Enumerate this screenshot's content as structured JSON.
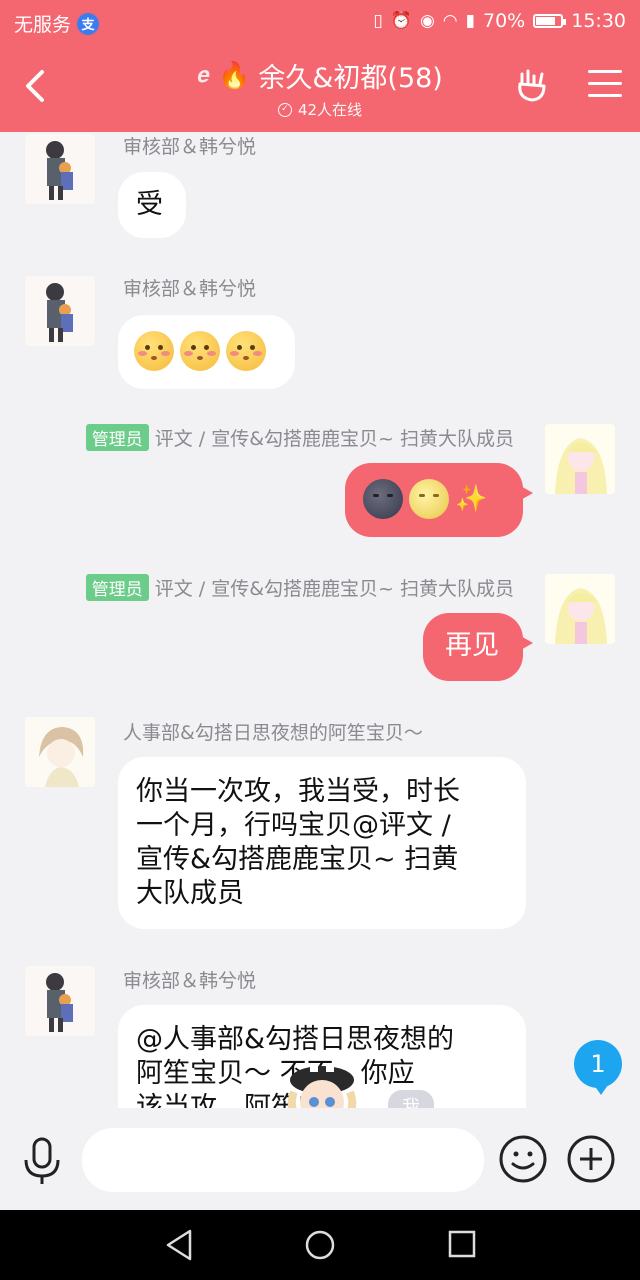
{
  "status_bar": {
    "carrier": "无服务",
    "alipay_icon": "支",
    "battery": "70%",
    "battery_level": 0.7,
    "time": "15:30"
  },
  "header": {
    "title": "余久&初都(58)",
    "online": "42人在线"
  },
  "messages": [
    {
      "sender": "审核部＆韩兮悦",
      "text": "受"
    },
    {
      "sender": "审核部＆韩兮悦",
      "emoji": [
        "shy-face",
        "shy-face",
        "shy-face"
      ]
    },
    {
      "badge": "管理员",
      "sender": "评文 / 宣传&勾搭鹿鹿宝贝~ 扫黄大队成员",
      "emoji": [
        "new-moon-face",
        "full-moon-face",
        "sparkles"
      ]
    },
    {
      "badge": "管理员",
      "sender": "评文 / 宣传&勾搭鹿鹿宝贝~ 扫黄大队成员",
      "text": "再见"
    },
    {
      "sender": "人事部&勾搭日思夜想的阿笙宝贝～",
      "lines": [
        "你当一次攻，我当受，时长",
        "一个月，行吗宝贝@评文 /",
        "宣传&勾搭鹿鹿宝贝~  扫黄",
        "大队成员"
      ]
    },
    {
      "sender": "审核部＆韩兮悦",
      "lines": [
        "@人事部&勾搭日思夜想的",
        "阿笙宝贝～ 不不，你应",
        "该当攻，阿笙宝"
      ]
    }
  ],
  "unread_count": "1",
  "me_tag": "我",
  "input": {
    "placeholder": ""
  }
}
